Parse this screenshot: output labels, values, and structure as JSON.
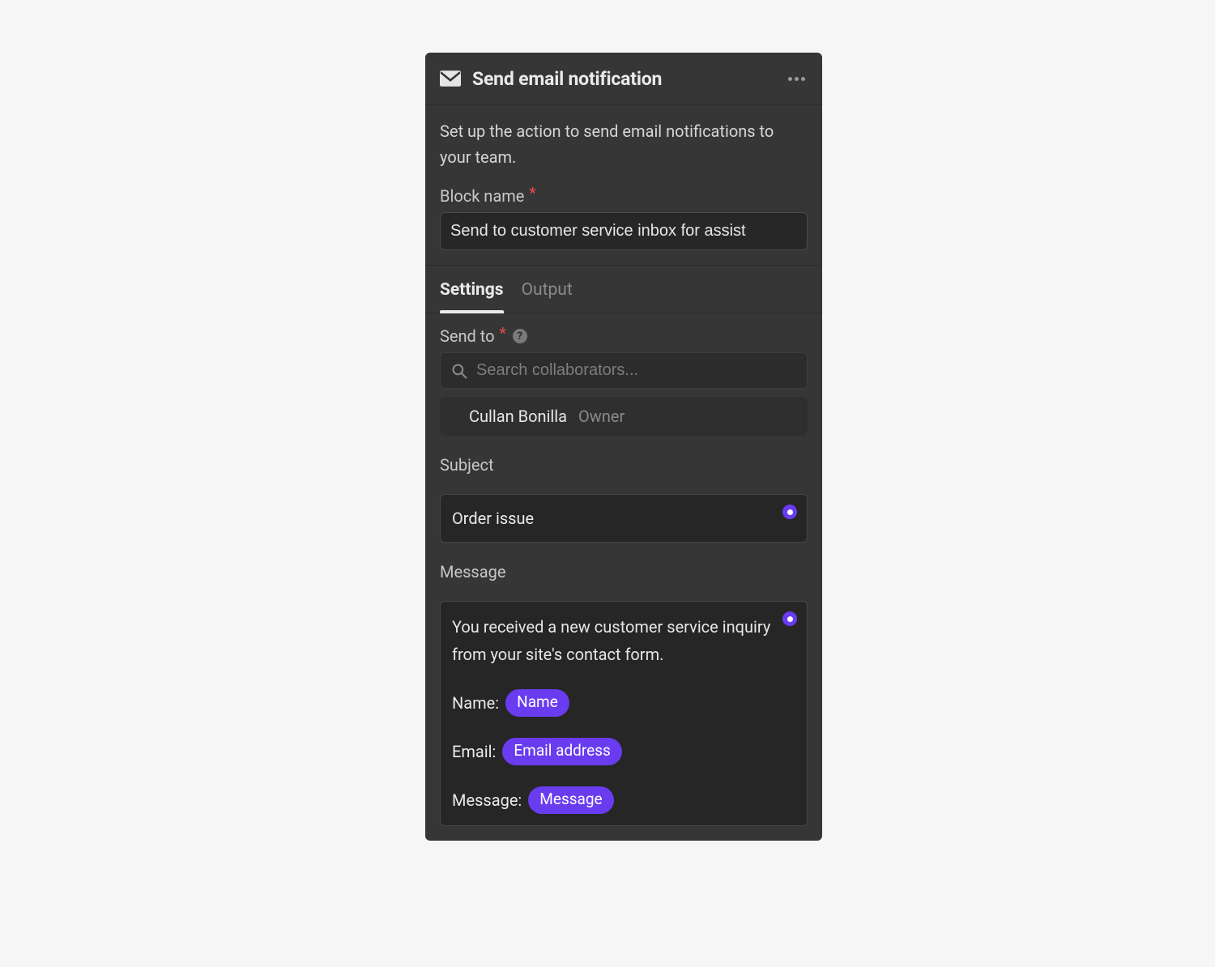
{
  "header": {
    "title": "Send email notification"
  },
  "description": "Set up the action to send email notifications to your team.",
  "blockName": {
    "label": "Block name",
    "value": "Send to customer service inbox for assist"
  },
  "tabs": {
    "settings": "Settings",
    "output": "Output"
  },
  "sendTo": {
    "label": "Send to",
    "placeholder": "Search collaborators...",
    "collaborator": {
      "name": "Cullan Bonilla",
      "role": "Owner"
    }
  },
  "subject": {
    "label": "Subject",
    "value": "Order issue"
  },
  "message": {
    "label": "Message",
    "intro": "You received a new customer service inquiry from your site's contact form.",
    "lines": {
      "nameLabel": "Name:",
      "namePill": "Name",
      "emailLabel": "Email:",
      "emailPill": "Email address",
      "messageLabel": "Message:",
      "messagePill": "Message"
    }
  },
  "icons": {
    "help": "?"
  }
}
